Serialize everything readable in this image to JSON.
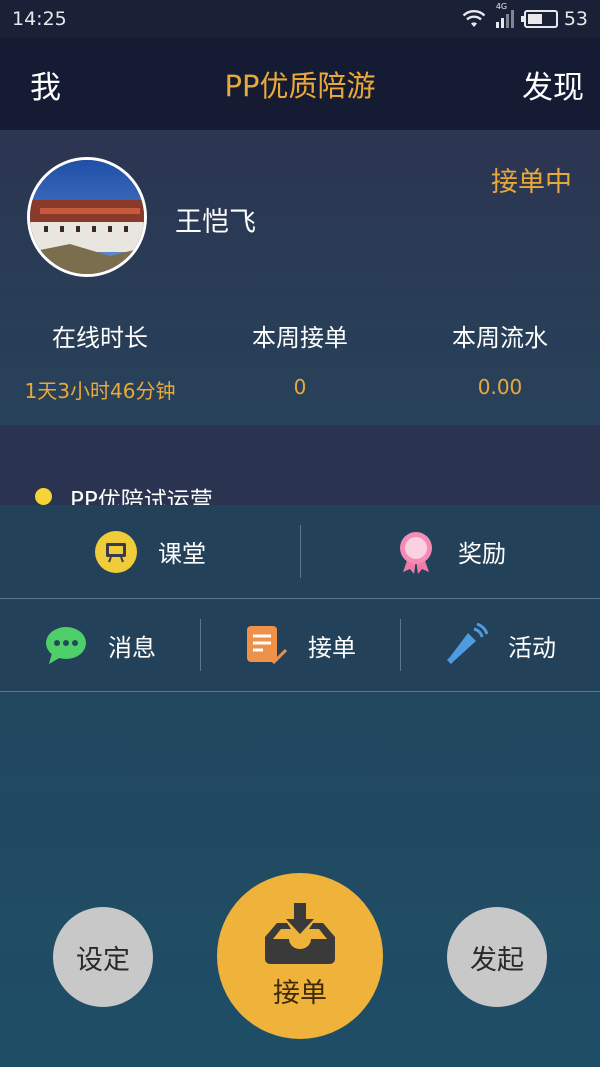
{
  "status_bar": {
    "time": "14:25",
    "network": "4G",
    "battery": "53",
    "battery_level": 0.53
  },
  "nav": {
    "left": "我",
    "title": "PP优质陪游",
    "right": "发现"
  },
  "profile": {
    "name": "王恺飞",
    "status": "接单中",
    "stats": [
      {
        "label": "在线时长",
        "value": "1天3小时46分钟"
      },
      {
        "label": "本周接单",
        "value": "0"
      },
      {
        "label": "本周流水",
        "value": "0.00"
      }
    ]
  },
  "notice": {
    "text": "PP优陪试运营"
  },
  "menu": {
    "row1": [
      {
        "label": "课堂",
        "icon": "classroom-icon"
      },
      {
        "label": "奖励",
        "icon": "award-icon"
      }
    ],
    "row2": [
      {
        "label": "消息",
        "icon": "message-icon"
      },
      {
        "label": "接单",
        "icon": "order-icon"
      },
      {
        "label": "活动",
        "icon": "megaphone-icon"
      }
    ]
  },
  "bottom": {
    "settings": "设定",
    "accept": "接单",
    "launch": "发起"
  },
  "colors": {
    "accent": "#e8a93a",
    "accept_button": "#efb23a",
    "notice_dot": "#f5d43a",
    "navbar": "#141b33"
  }
}
